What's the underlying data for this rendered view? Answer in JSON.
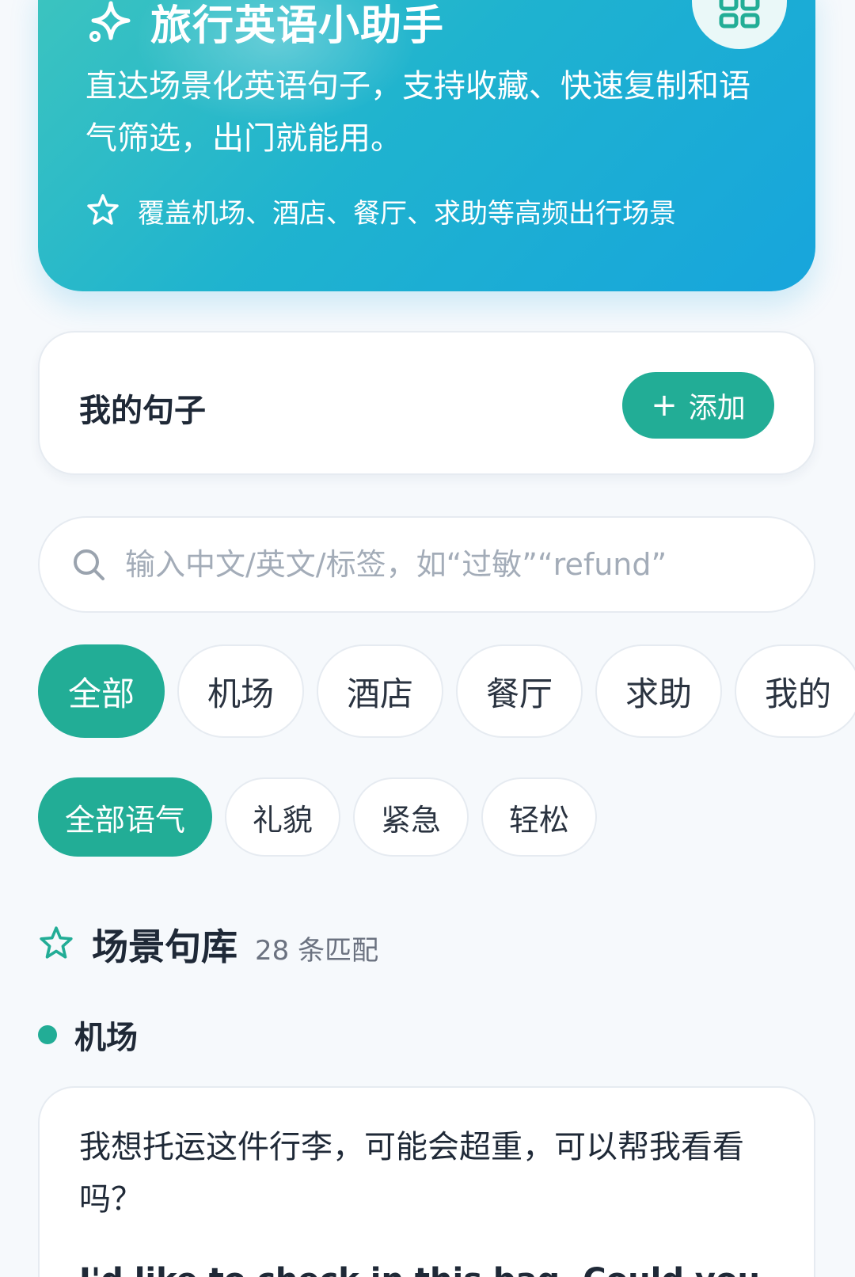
{
  "hero": {
    "title": "旅行英语小助手",
    "description": "直达场景化英语句子，支持收藏、快速复制和语气筛选，出门就能用。",
    "feature": "覆盖机场、酒店、餐厅、求助等高频出行场景",
    "icons": {
      "title": "sparkle-icon",
      "menu": "grid-icon",
      "feature": "star-icon"
    }
  },
  "my_sentences": {
    "title": "我的句子",
    "add_label": "添加"
  },
  "search": {
    "placeholder": "输入中文/英文/标签，如“过敏”“refund”",
    "value": ""
  },
  "scene_filters": [
    "全部",
    "机场",
    "酒店",
    "餐厅",
    "求助",
    "我的"
  ],
  "scene_active": "全部",
  "tone_filters": [
    "全部语气",
    "礼貌",
    "紧急",
    "轻松"
  ],
  "tone_active": "全部语气",
  "library": {
    "title": "场景句库",
    "count": "28 条匹配"
  },
  "group": {
    "title": "机场"
  },
  "sentence": {
    "zh": "我想托运这件行李，可能会超重，可以帮我看看吗？",
    "en": "I'd like to check in this bag. Could you"
  },
  "colors": {
    "accent": "#22ad96",
    "hero_start": "#3cc4bf",
    "hero_end": "#17a5dc",
    "background": "#f6f9fc"
  }
}
